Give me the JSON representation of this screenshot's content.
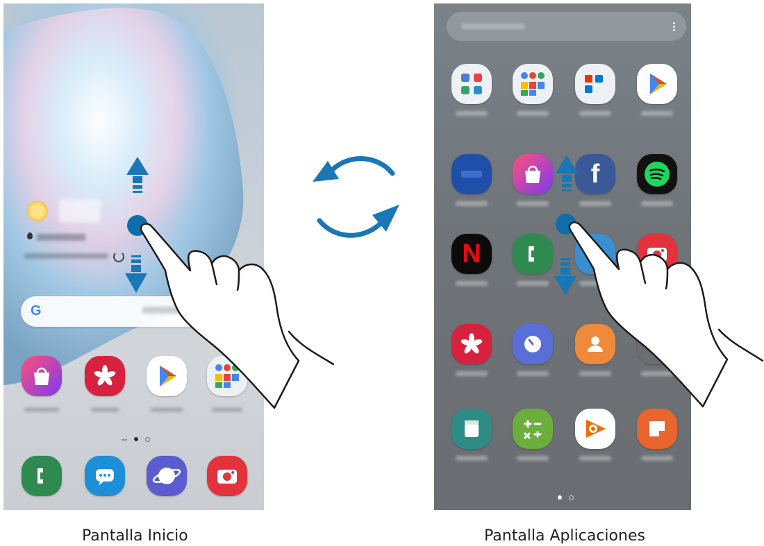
{
  "captions": {
    "home": "Pantalla Inicio",
    "apps": "Pantalla Aplicaciones"
  },
  "home_screen": {
    "search_logo": "G",
    "dock_apps": [
      "phone-icon",
      "messages-icon",
      "internet-icon",
      "camera-icon"
    ],
    "row_apps": [
      "galaxy-store-icon",
      "gallery-icon",
      "play-store-icon",
      "google-folder-icon"
    ]
  },
  "apps_screen": {
    "grid_apps": [
      "samsung-folder-icon",
      "google-folder-icon",
      "microsoft-folder-icon",
      "play-store-icon",
      "samsung-pay-icon",
      "galaxy-store-icon",
      "facebook-icon",
      "spotify-icon",
      "netflix-icon",
      "phone-icon",
      "blue-app-icon",
      "camera-icon",
      "gallery-icon",
      "clock-icon",
      "contacts-icon",
      "unknown-app-icon",
      "calendar-icon",
      "calculator-icon",
      "play-music-icon",
      "samsung-notes-icon"
    ],
    "glyphs": {
      "netflix": "N",
      "facebook": "f"
    }
  },
  "colors": {
    "gesture_blue": "#0d6ea9",
    "arrow_blue": "#1a76b5"
  }
}
